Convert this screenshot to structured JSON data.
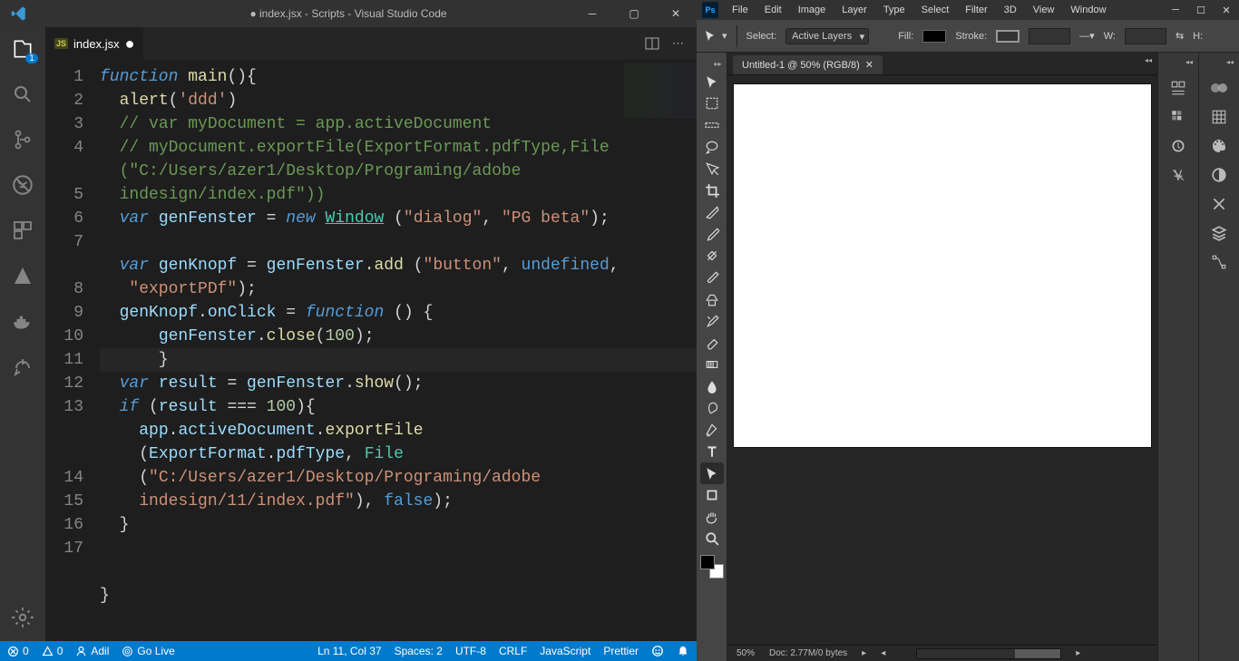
{
  "vscode": {
    "title": "● index.jsx - Scripts - Visual Studio Code",
    "activity_badge": "1",
    "tab": {
      "icon": "JS",
      "name": "index.jsx"
    },
    "line_numbers": [
      1,
      2,
      3,
      4,
      "",
      5,
      6,
      7,
      "",
      8,
      9,
      10,
      11,
      12,
      13,
      "",
      "",
      14,
      15,
      16,
      17
    ],
    "highlight_line_index": 10,
    "code_lines": [
      [
        [
          "kw",
          "function"
        ],
        [
          "op",
          " "
        ],
        [
          "fn",
          "main"
        ],
        [
          "op",
          "(){"
        ]
      ],
      [
        [
          "op",
          "  "
        ],
        [
          "fn",
          "alert"
        ],
        [
          "op",
          "("
        ],
        [
          "str",
          "'ddd'"
        ],
        [
          "op",
          ")"
        ]
      ],
      [
        [
          "op",
          "  "
        ],
        [
          "cmt",
          "// var myDocument = app.activeDocument"
        ]
      ],
      [
        [
          "op",
          "  "
        ],
        [
          "cmt",
          "// myDocument.exportFile(ExportFormat.pdfType,File"
        ]
      ],
      [
        [
          "cmt",
          "  (\"C:/Users/azer1/Desktop/Programing/adobe "
        ]
      ],
      [
        [
          "cmt",
          "  indesign/index.pdf\"))"
        ]
      ],
      [
        [
          "op",
          "  "
        ],
        [
          "kw",
          "var"
        ],
        [
          "op",
          " "
        ],
        [
          "var",
          "genFenster"
        ],
        [
          "op",
          " = "
        ],
        [
          "kw",
          "new"
        ],
        [
          "op",
          " "
        ],
        [
          "type underline",
          "Window"
        ],
        [
          "op",
          " ("
        ],
        [
          "str",
          "\"dialog\""
        ],
        [
          "op",
          ", "
        ],
        [
          "str",
          "\"PG beta\""
        ],
        [
          "op",
          ");"
        ]
      ],
      [
        [
          "op",
          " "
        ]
      ],
      [
        [
          "op",
          "  "
        ],
        [
          "kw",
          "var"
        ],
        [
          "op",
          " "
        ],
        [
          "var",
          "genKnopf"
        ],
        [
          "op",
          " = "
        ],
        [
          "var",
          "genFenster"
        ],
        [
          "op",
          "."
        ],
        [
          "fn",
          "add"
        ],
        [
          "op",
          " ("
        ],
        [
          "str",
          "\"button\""
        ],
        [
          "op",
          ", "
        ],
        [
          "const",
          "undefined"
        ],
        [
          "op",
          ","
        ]
      ],
      [
        [
          "op",
          "   "
        ],
        [
          "str",
          "\"exportPDf\""
        ],
        [
          "op",
          ");"
        ]
      ],
      [
        [
          "op",
          "  "
        ],
        [
          "var",
          "genKnopf"
        ],
        [
          "op",
          "."
        ],
        [
          "var",
          "onClick"
        ],
        [
          "op",
          " = "
        ],
        [
          "kw",
          "function"
        ],
        [
          "op",
          " () {"
        ]
      ],
      [
        [
          "op",
          "      "
        ],
        [
          "var",
          "genFenster"
        ],
        [
          "op",
          "."
        ],
        [
          "fn",
          "close"
        ],
        [
          "op",
          "("
        ],
        [
          "num",
          "100"
        ],
        [
          "op",
          ");"
        ]
      ],
      [
        [
          "op",
          "      }"
        ]
      ],
      [
        [
          "op",
          "  "
        ],
        [
          "kw",
          "var"
        ],
        [
          "op",
          " "
        ],
        [
          "var",
          "result"
        ],
        [
          "op",
          " = "
        ],
        [
          "var",
          "genFenster"
        ],
        [
          "op",
          "."
        ],
        [
          "fn",
          "show"
        ],
        [
          "op",
          "();"
        ]
      ],
      [
        [
          "op",
          "  "
        ],
        [
          "kw",
          "if"
        ],
        [
          "op",
          " ("
        ],
        [
          "var",
          "result"
        ],
        [
          "op",
          " === "
        ],
        [
          "num",
          "100"
        ],
        [
          "op",
          "){"
        ]
      ],
      [
        [
          "op",
          "    "
        ],
        [
          "var",
          "app"
        ],
        [
          "op",
          "."
        ],
        [
          "var",
          "activeDocument"
        ],
        [
          "op",
          "."
        ],
        [
          "fn",
          "exportFile"
        ]
      ],
      [
        [
          "op",
          "    ("
        ],
        [
          "var",
          "ExportFormat"
        ],
        [
          "op",
          "."
        ],
        [
          "var",
          "pdfType"
        ],
        [
          "op",
          ", "
        ],
        [
          "type",
          "File"
        ]
      ],
      [
        [
          "op",
          "    ("
        ],
        [
          "str",
          "\"C:/Users/azer1/Desktop/Programing/adobe "
        ]
      ],
      [
        [
          "str",
          "    indesign/11/index.pdf\""
        ],
        [
          "op",
          "), "
        ],
        [
          "const",
          "false"
        ],
        [
          "op",
          ");"
        ]
      ],
      [
        [
          "op",
          "  }"
        ]
      ],
      [
        [
          "op",
          " "
        ]
      ],
      [
        [
          "op",
          " "
        ]
      ],
      [
        [
          "op",
          "}"
        ]
      ]
    ],
    "status": {
      "errors": "0",
      "warnings": "0",
      "user": "Adil",
      "golive": "Go Live",
      "position": "Ln 11, Col 37",
      "spaces": "Spaces: 2",
      "encoding": "UTF-8",
      "eol": "CRLF",
      "lang": "JavaScript",
      "formatter": "Prettier"
    }
  },
  "ps": {
    "menu": [
      "File",
      "Edit",
      "Image",
      "Layer",
      "Type",
      "Select",
      "Filter",
      "3D",
      "View",
      "Window"
    ],
    "options": {
      "select_label": "Select:",
      "select_value": "Active Layers",
      "fill_label": "Fill:",
      "stroke_label": "Stroke:",
      "w_label": "W:",
      "h_label": "H:"
    },
    "doc_tab": "Untitled-1 @ 50% (RGB/8)",
    "zoom": "50%",
    "docinfo": "Doc: 2.77M/0 bytes",
    "tools": [
      "move",
      "marquee",
      "marquee-row",
      "lasso",
      "quick-select",
      "crop",
      "slice",
      "eyedropper",
      "patch",
      "brush",
      "clone",
      "history-brush",
      "eraser",
      "gradient",
      "blur",
      "dodge",
      "pen",
      "type",
      "path",
      "shape",
      "hand",
      "zoom"
    ]
  }
}
